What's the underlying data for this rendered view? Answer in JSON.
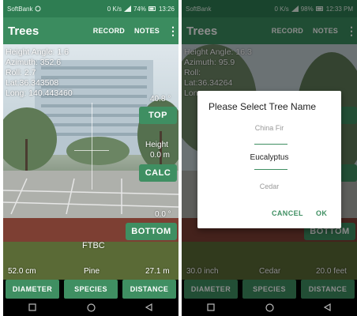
{
  "left": {
    "status": {
      "carrier": "SoftBank",
      "right": "0 K/s",
      "battery": "74%",
      "time": "13:26"
    },
    "appbar": {
      "title": "Trees",
      "record": "RECORD",
      "notes": "NOTES",
      "menu": "⋮"
    },
    "info": {
      "height_angle": "Height Angle: 1.6",
      "azimuth": "Azimuth: 352.6",
      "roll": "Roll: 2.7",
      "lat": "Lat:36.343508",
      "long": "Long: 140.443460"
    },
    "readouts": {
      "angle_top": "40.8 °",
      "height_label": "Height",
      "height_value": "0.0 m",
      "angle_bottom": "0.0 °",
      "ftbc": "FTBC",
      "diameter_value": "52.0 cm",
      "species_value": "Pine",
      "distance_value": "27.1 m"
    },
    "buttons": {
      "top": "TOP",
      "calc": "CALC",
      "bottom": "BOTTOM"
    },
    "bottom_buttons": {
      "diameter": "DIAMETER",
      "species": "SPECIES",
      "distance": "DISTANCE"
    }
  },
  "right": {
    "status": {
      "carrier": "SoftBank",
      "right": "0 K/s",
      "battery": "98%",
      "time": "12:33 PM"
    },
    "appbar": {
      "title": "Trees",
      "record": "RECORD",
      "notes": "NOTES",
      "menu": "⋮"
    },
    "info": {
      "height_angle": "Height Angle: 16.3",
      "azimuth": "Azimuth: 95.9",
      "roll": "Roll:",
      "lat": "Lat:36.34264",
      "long": "Long"
    },
    "readouts": {
      "diameter_value": "30.0 inch",
      "species_value": "Cedar",
      "distance_value": "20.0 feet"
    },
    "buttons": {
      "bottom": "BOTTOM"
    },
    "bottom_buttons": {
      "diameter": "DIAMETER",
      "species": "SPECIES",
      "distance": "DISTANCE"
    },
    "dialog": {
      "title": "Please Select Tree Name",
      "options": [
        "China Fir",
        "Eucalyptus",
        "Cedar"
      ],
      "selected": "Eucalyptus",
      "cancel": "CANCEL",
      "ok": "OK"
    }
  },
  "colors": {
    "accent": "#3f8f62",
    "appbar": "#3b8c5f",
    "statusbar": "#2e7d52"
  }
}
